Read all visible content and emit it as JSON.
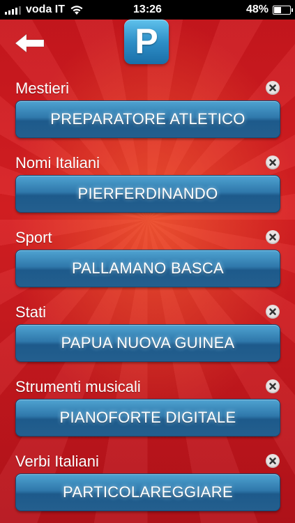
{
  "status_bar": {
    "carrier": "voda IT",
    "time": "13:26",
    "battery": "48%",
    "battery_level": 0.48
  },
  "header": {
    "back_icon": "back-arrow-icon",
    "letter": "P"
  },
  "colors": {
    "background": "#d81f22",
    "answer_button": "#2f78ab",
    "letter_tile": "#2e8fc7"
  },
  "categories": [
    {
      "label": "Mestieri",
      "answer": "PREPARATORE ATLETICO"
    },
    {
      "label": "Nomi Italiani",
      "answer": "PIERFERDINANDO"
    },
    {
      "label": "Sport",
      "answer": "PALLAMANO BASCA"
    },
    {
      "label": "Stati",
      "answer": "PAPUA NUOVA GUINEA"
    },
    {
      "label": "Strumenti musicali",
      "answer": "PIANOFORTE DIGITALE"
    },
    {
      "label": "Verbi Italiani",
      "answer": "PARTICOLAREGGIARE"
    }
  ]
}
